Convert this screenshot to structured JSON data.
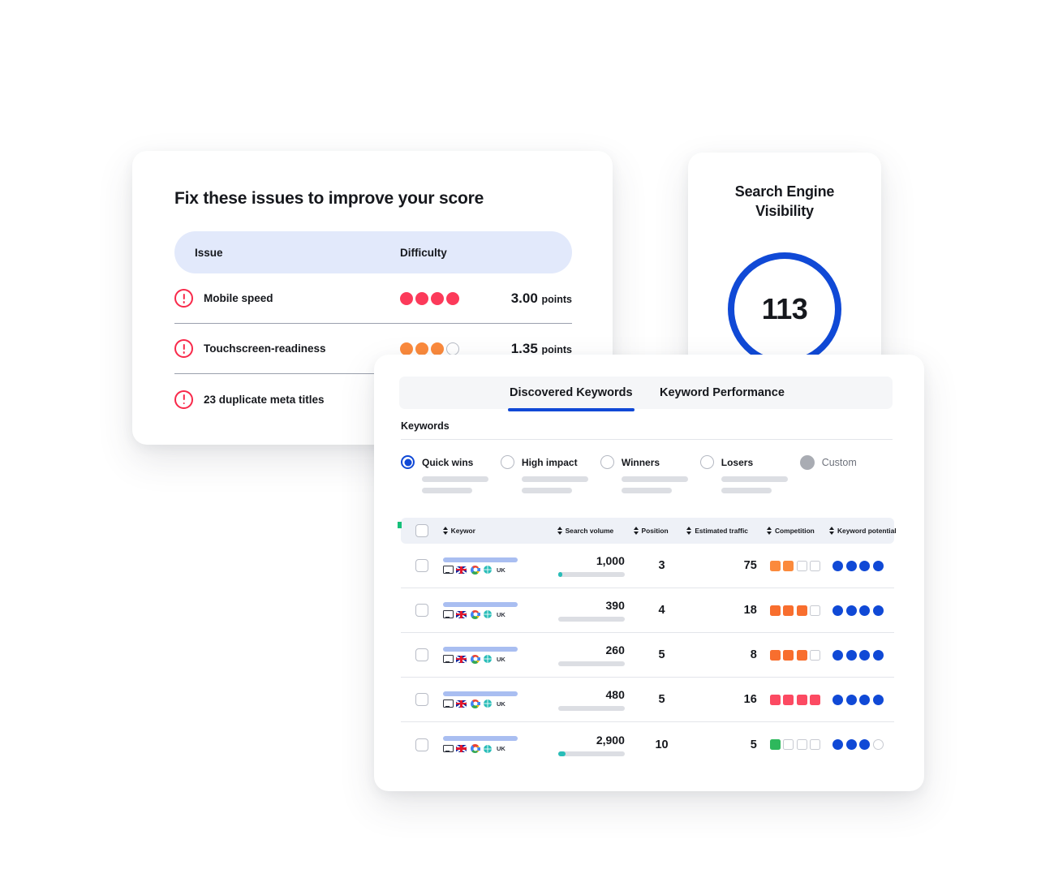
{
  "colors": {
    "blue": "#1049d6",
    "red": "#fc3a5a",
    "orange": "#fb8a3c",
    "orange_strong": "#f86e2e",
    "green": "#2eb85c",
    "teal": "#29bdb8",
    "gray": "#a9acb3",
    "header_bg": "#e2e9fb",
    "table_header_bg": "#eef1f7"
  },
  "issues_card": {
    "title": "Fix these issues to improve your score",
    "columns": {
      "issue": "Issue",
      "difficulty": "Difficulty"
    },
    "rows": [
      {
        "icon": "alert-circle-icon",
        "label": "Mobile speed",
        "difficulty_filled": 4,
        "difficulty_total": 4,
        "difficulty_color": "#fc3a5a",
        "points_value": "3.00",
        "points_unit": "points"
      },
      {
        "icon": "alert-circle-icon",
        "label": "Touchscreen-readiness",
        "difficulty_filled": 3,
        "difficulty_total": 4,
        "difficulty_color": "#fb8a3c",
        "points_value": "1.35",
        "points_unit": "points"
      },
      {
        "icon": "alert-circle-icon",
        "label": "23 duplicate meta titles",
        "difficulty_filled": 0,
        "difficulty_total": 0,
        "difficulty_color": "#fc3a5a",
        "points_value": "",
        "points_unit": ""
      }
    ]
  },
  "visibility_card": {
    "title_line1": "Search Engine",
    "title_line2": "Visibility",
    "score": "113",
    "ring_color": "#1049d6"
  },
  "keywords_card": {
    "tabs": [
      {
        "label": "Discovered Keywords",
        "active": true
      },
      {
        "label": "Keyword Performance",
        "active": false
      }
    ],
    "section_heading": "Keywords",
    "filters": [
      {
        "label": "Quick wins",
        "state": "checked",
        "style": "radio"
      },
      {
        "label": "High impact",
        "state": "unchecked",
        "style": "radio"
      },
      {
        "label": "Winners",
        "state": "unchecked",
        "style": "radio"
      },
      {
        "label": "Losers",
        "state": "unchecked",
        "style": "radio"
      },
      {
        "label": "Custom",
        "state": "solid",
        "style": "solid"
      }
    ],
    "table": {
      "columns": [
        {
          "key": "checkbox",
          "label": "",
          "sortable": false
        },
        {
          "key": "keyword",
          "label": "Keywor",
          "sortable": true
        },
        {
          "key": "search_volume",
          "label": "Search volume",
          "sortable": true
        },
        {
          "key": "position",
          "label": "Position",
          "sortable": true
        },
        {
          "key": "estimated_traffic",
          "label": "Estimated traffic",
          "sortable": true
        },
        {
          "key": "competition",
          "label": "Competition",
          "sortable": true
        },
        {
          "key": "keyword_potential",
          "label": "Keyword potential",
          "sortable": true
        }
      ],
      "row_icons": [
        "monitor-icon",
        "uk-flag-icon",
        "google-icon",
        "globe-icon"
      ],
      "row_geo_label": "UK",
      "rows": [
        {
          "selected": false,
          "keyword_redacted": true,
          "search_volume": "1,000",
          "volume_fill_pct": 6,
          "position": "3",
          "estimated_traffic": "75",
          "competition_filled": 2,
          "competition_total": 4,
          "competition_color": "#fb8a3c",
          "potential_filled": 4,
          "potential_total": 4,
          "potential_color": "#1049d6"
        },
        {
          "selected": false,
          "keyword_redacted": true,
          "search_volume": "390",
          "volume_fill_pct": 0,
          "position": "4",
          "estimated_traffic": "18",
          "competition_filled": 3,
          "competition_total": 4,
          "competition_color": "#f86e2e",
          "potential_filled": 4,
          "potential_total": 4,
          "potential_color": "#1049d6"
        },
        {
          "selected": false,
          "keyword_redacted": true,
          "search_volume": "260",
          "volume_fill_pct": 0,
          "position": "5",
          "estimated_traffic": "8",
          "competition_filled": 3,
          "competition_total": 4,
          "competition_color": "#f86e2e",
          "potential_filled": 4,
          "potential_total": 4,
          "potential_color": "#1049d6"
        },
        {
          "selected": false,
          "keyword_redacted": true,
          "search_volume": "480",
          "volume_fill_pct": 0,
          "position": "5",
          "estimated_traffic": "16",
          "competition_filled": 4,
          "competition_total": 4,
          "competition_color": "#fc4a62",
          "potential_filled": 4,
          "potential_total": 4,
          "potential_color": "#1049d6"
        },
        {
          "selected": false,
          "keyword_redacted": true,
          "search_volume": "2,900",
          "volume_fill_pct": 11,
          "position": "10",
          "estimated_traffic": "5",
          "competition_filled": 1,
          "competition_total": 4,
          "competition_color": "#2eb85c",
          "potential_filled": 3,
          "potential_total": 4,
          "potential_color": "#1049d6"
        }
      ]
    }
  }
}
